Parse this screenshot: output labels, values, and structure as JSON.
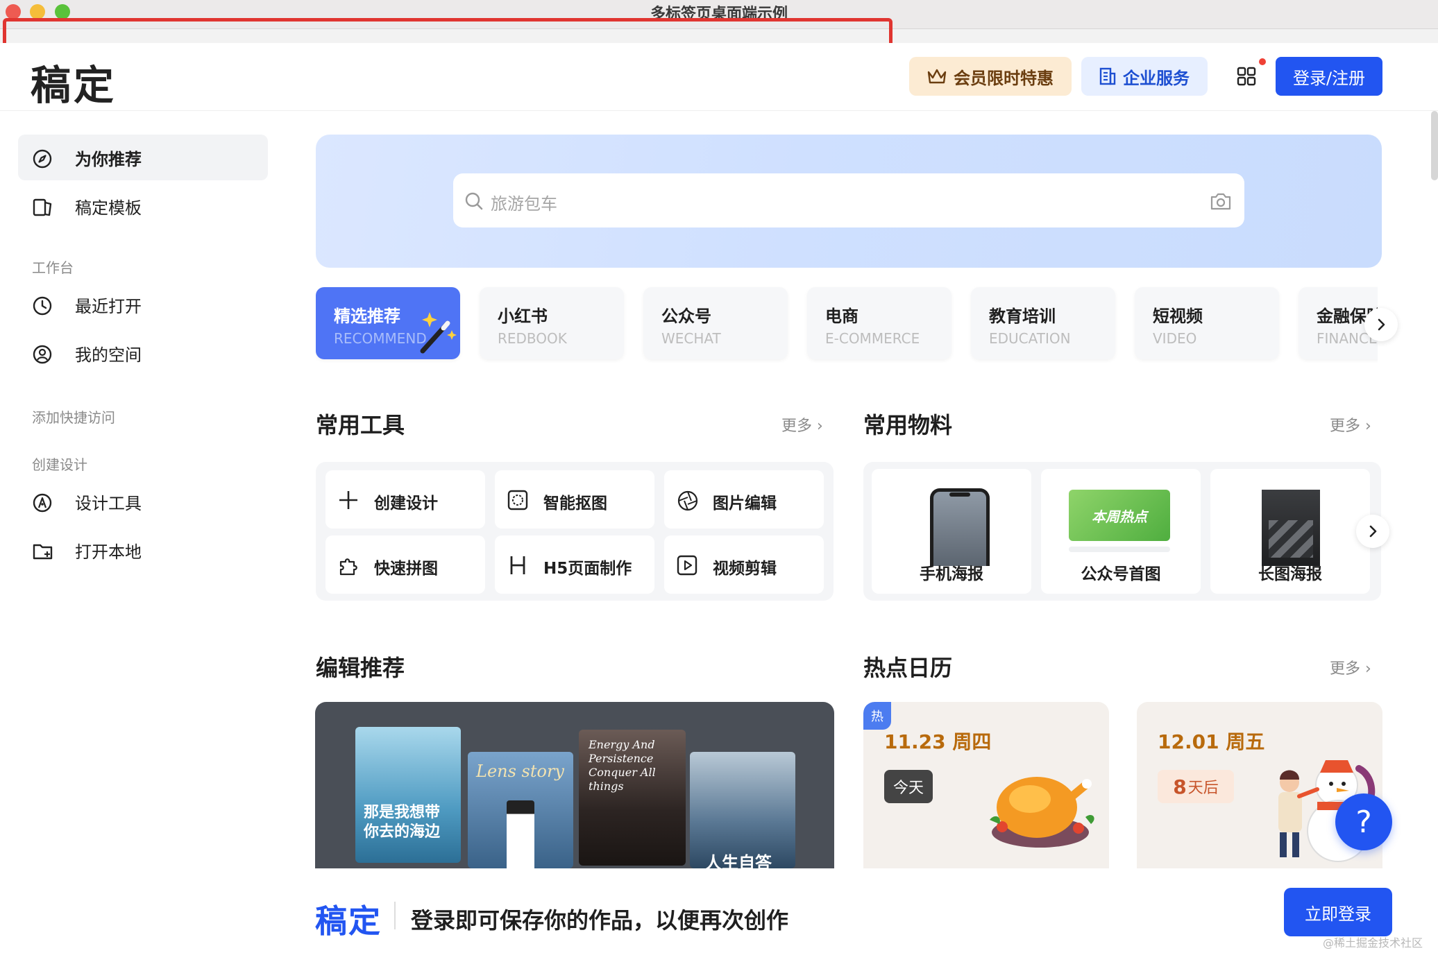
{
  "window": {
    "title": "多标签页桌面端示例"
  },
  "header": {
    "logo": "稿定",
    "vip_label": "会员限时特惠",
    "enterprise_label": "企业服务",
    "login_label": "登录/注册"
  },
  "sidebar": {
    "items": [
      {
        "label": "为你推荐",
        "icon": "compass-icon",
        "active": true
      },
      {
        "label": "稿定模板",
        "icon": "template-icon"
      }
    ],
    "groups": [
      {
        "title": "工作台",
        "items": [
          {
            "label": "最近打开",
            "icon": "clock-icon"
          },
          {
            "label": "我的空间",
            "icon": "user-circle-icon"
          }
        ]
      },
      {
        "title": "添加快捷访问",
        "items": []
      },
      {
        "title": "创建设计",
        "items": [
          {
            "label": "设计工具",
            "icon": "pen-nib-icon"
          },
          {
            "label": "打开本地",
            "icon": "folder-plus-icon"
          }
        ]
      }
    ]
  },
  "search": {
    "placeholder": "旅游包车"
  },
  "categories": [
    {
      "title": "精选推荐",
      "en": "RECOMMEND",
      "active": true
    },
    {
      "title": "小红书",
      "en": "REDBOOK"
    },
    {
      "title": "公众号",
      "en": "WECHAT"
    },
    {
      "title": "电商",
      "en": "E-COMMERCE"
    },
    {
      "title": "教育培训",
      "en": "EDUCATION"
    },
    {
      "title": "短视频",
      "en": "VIDEO"
    },
    {
      "title": "金融保险",
      "en": "FINANCE"
    }
  ],
  "sections": {
    "tools_title": "常用工具",
    "materials_title": "常用物料",
    "editor_title": "编辑推荐",
    "calendar_title": "热点日历",
    "more_label": "更多"
  },
  "tools": [
    {
      "label": "创建设计",
      "icon": "plus-icon"
    },
    {
      "label": "智能抠图",
      "icon": "cutout-icon"
    },
    {
      "label": "图片编辑",
      "icon": "aperture-icon"
    },
    {
      "label": "快速拼图",
      "icon": "puzzle-icon"
    },
    {
      "label": "H5页面制作",
      "icon": "h5-icon"
    },
    {
      "label": "视频剪辑",
      "icon": "video-play-icon"
    }
  ],
  "materials": [
    {
      "label": "手机海报"
    },
    {
      "label": "公众号首图",
      "thumb_text": "本周热点"
    },
    {
      "label": "长图海报"
    }
  ],
  "editor_posters": [
    {
      "text": "那是我想带你去的海边"
    },
    {
      "text": "Lens story"
    },
    {
      "text": "Energy And Persistence Conquer All things"
    },
    {
      "text": "人生自答"
    }
  ],
  "calendar": [
    {
      "date": "11.23 周四",
      "tag": "今天",
      "hot": "热"
    },
    {
      "date": "12.01 周五",
      "days_num": "8",
      "days_suffix": "天后"
    }
  ],
  "login_bar": {
    "logo": "稿定",
    "text": "登录即可保存你的作品，以便再次创作",
    "button": "立即登录"
  },
  "help_label": "?",
  "watermark": "@稀土掘金技术社区",
  "colors": {
    "brand": "#2255f1",
    "vip_bg": "#fcebd3",
    "enterprise_bg": "#e7efff",
    "active_cat": "#4f74f5"
  }
}
